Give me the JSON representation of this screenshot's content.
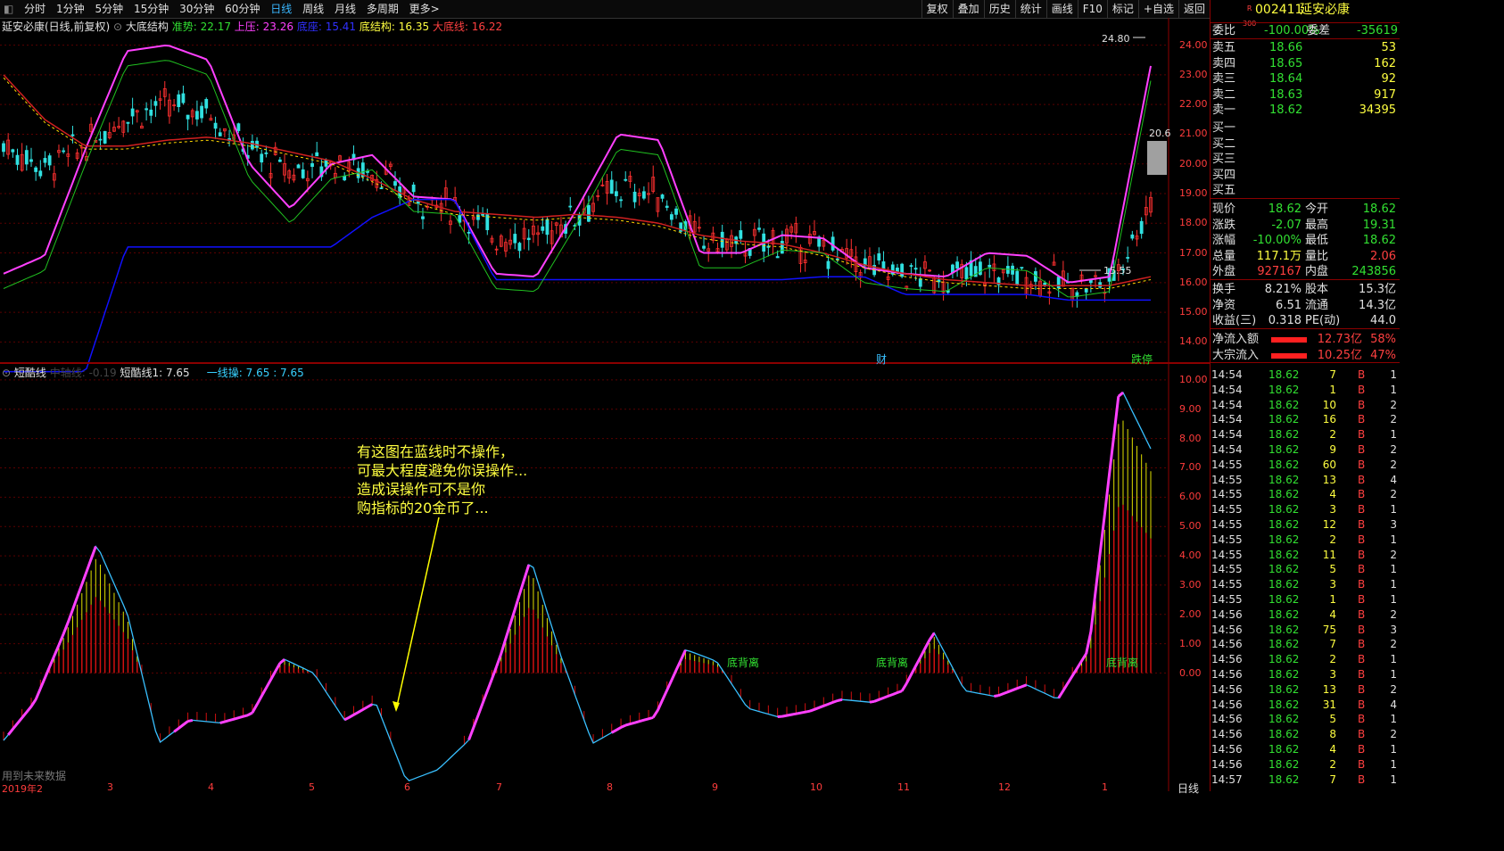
{
  "toolbar": {
    "periods": [
      "分时",
      "1分钟",
      "5分钟",
      "15分钟",
      "30分钟",
      "60分钟",
      "日线",
      "周线",
      "月线",
      "多周期",
      "更多>"
    ],
    "active_period": "日线",
    "right_buttons": [
      "复权",
      "叠加",
      "历史",
      "统计",
      "画线",
      "F10",
      "标记",
      "+自选",
      "返回"
    ]
  },
  "main_header": {
    "title": "延安必康(日线,前复权)",
    "indicator": "大底结构",
    "zhunshi": "准势: 22.17",
    "shangya": "上压: 23.26",
    "diceng": "底座: 15.41",
    "dijiegou": "底结构: 16.35",
    "dadixian": "大底线: 16.22"
  },
  "main_annotations": {
    "high": "24.80",
    "low": "15.55",
    "side": "20.6",
    "cai": "财",
    "dietei": "跌停"
  },
  "sub_header": {
    "name": "短酷线",
    "mid": "中轴线: -0.19",
    "line1": "短酷线1: 7.65",
    "line2": "一线操: 7.65",
    "line3": ": 7.65"
  },
  "annotation": {
    "lines": [
      "有这图在蓝线时不操作，",
      "可最大程度避免你误操作...",
      "造成误操作可不是你",
      "购指标的20金币了..."
    ]
  },
  "labels": {
    "dibeili1": "底背离",
    "dibeili2": "底背离",
    "dibeili3": "底背离",
    "future_data": "用到未来数据",
    "period_tab": "日线"
  },
  "chart_data": [
    {
      "type": "line",
      "title": "延安必康(日线,前复权)",
      "y_ticks": [
        "24.00",
        "23.00",
        "22.00",
        "21.00",
        "20.00",
        "19.00",
        "18.00",
        "17.00",
        "16.00",
        "15.00",
        "14.00"
      ],
      "ylim": [
        13.5,
        24.8
      ],
      "series": [
        {
          "name": "准势",
          "color": "#ff40ff",
          "values": [
            16.3,
            16.9,
            20.5,
            23.8,
            24.0,
            23.5,
            20.0,
            18.5,
            20.0,
            20.3,
            18.9,
            18.8,
            16.3,
            16.2,
            18.5,
            21.0,
            20.8,
            17.0,
            17.0,
            17.6,
            17.5,
            16.5,
            16.3,
            16.2,
            17.0,
            16.9,
            16.0,
            16.2,
            23.3
          ]
        },
        {
          "name": "大底线",
          "color": "#d02020",
          "values": [
            23.0,
            21.5,
            20.6,
            20.6,
            20.8,
            20.9,
            20.7,
            20.4,
            20.1,
            19.5,
            18.8,
            18.4,
            18.3,
            18.2,
            18.3,
            18.2,
            18.0,
            17.6,
            17.4,
            17.3,
            17.0,
            16.6,
            16.3,
            16.1,
            16.0,
            15.9,
            15.9,
            15.9,
            16.2
          ]
        },
        {
          "name": "底座",
          "color": "#1010ff",
          "values": [
            13.0,
            13.0,
            13.0,
            17.2,
            17.2,
            17.2,
            17.2,
            17.2,
            17.2,
            18.2,
            18.8,
            18.8,
            16.1,
            16.1,
            16.1,
            16.1,
            16.1,
            16.1,
            16.1,
            16.1,
            16.2,
            16.2,
            15.6,
            15.6,
            15.6,
            15.6,
            15.41,
            15.41,
            15.41
          ]
        }
      ]
    },
    {
      "type": "line",
      "title": "短酷线",
      "y_ticks": [
        "10.00",
        "9.00",
        "8.00",
        "7.00",
        "6.00",
        "5.00",
        "4.00",
        "3.00",
        "2.00",
        "1.00",
        "0.00"
      ],
      "ylim": [
        -4.0,
        10.3
      ],
      "x_labels": [
        "2019年2",
        "3",
        "4",
        "5",
        "6",
        "7",
        "8",
        "9",
        "10",
        "11",
        "12",
        "1"
      ],
      "series": [
        {
          "name": "短酷线1",
          "color": "#39c0ff",
          "values": [
            -2.3,
            -1.0,
            1.5,
            4.4,
            2.0,
            -2.4,
            -1.6,
            -1.7,
            -1.4,
            0.5,
            0.0,
            -1.6,
            -1.0,
            -3.7,
            -3.3,
            -2.3,
            0.5,
            3.9,
            0.5,
            -2.4,
            -1.8,
            -1.5,
            0.8,
            0.4,
            -1.2,
            -1.5,
            -1.3,
            -0.9,
            -1.0,
            -0.6,
            1.4,
            -0.6,
            -0.8,
            -0.4,
            -0.9,
            0.8,
            9.8,
            7.65
          ]
        }
      ]
    }
  ],
  "quote": {
    "code": "002411",
    "name": "延安必康",
    "weibi_label": "委比",
    "weibi": "-100.00%",
    "weicha_label": "委差",
    "weicha": "-35619",
    "asks": [
      {
        "label": "卖五",
        "price": "18.66",
        "vol": "53"
      },
      {
        "label": "卖四",
        "price": "18.65",
        "vol": "162"
      },
      {
        "label": "卖三",
        "price": "18.64",
        "vol": "92"
      },
      {
        "label": "卖二",
        "price": "18.63",
        "vol": "917"
      },
      {
        "label": "卖一",
        "price": "18.62",
        "vol": "34395"
      }
    ],
    "bids": [
      {
        "label": "买一",
        "price": "",
        "vol": ""
      },
      {
        "label": "买二",
        "price": "",
        "vol": ""
      },
      {
        "label": "买三",
        "price": "",
        "vol": ""
      },
      {
        "label": "买四",
        "price": "",
        "vol": ""
      },
      {
        "label": "买五",
        "price": "",
        "vol": ""
      }
    ],
    "stats": [
      {
        "l1": "现价",
        "v1": "18.62",
        "c1": "green",
        "l2": "今开",
        "v2": "18.62",
        "c2": "green"
      },
      {
        "l1": "涨跌",
        "v1": "-2.07",
        "c1": "green",
        "l2": "最高",
        "v2": "19.31",
        "c2": "green"
      },
      {
        "l1": "涨幅",
        "v1": "-10.00%",
        "c1": "green",
        "l2": "最低",
        "v2": "18.62",
        "c2": "green"
      },
      {
        "l1": "总量",
        "v1": "117.1万",
        "c1": "yellow",
        "l2": "量比",
        "v2": "2.06",
        "c2": "red"
      },
      {
        "l1": "外盘",
        "v1": "927167",
        "c1": "red",
        "l2": "内盘",
        "v2": "243856",
        "c2": "green"
      }
    ],
    "stats2": [
      {
        "l1": "换手",
        "v1": "8.21%",
        "l2": "股本",
        "v2": "15.3亿"
      },
      {
        "l1": "净资",
        "v1": "6.51",
        "l2": "流通",
        "v2": "14.3亿"
      },
      {
        "l1": "收益(三)",
        "v1": "0.318",
        "l2": "PE(动)",
        "v2": "44.0"
      }
    ],
    "flows": [
      {
        "label": "净流入额",
        "value": "12.73亿",
        "pct": "58%"
      },
      {
        "label": "大宗流入",
        "value": "10.25亿",
        "pct": "47%"
      }
    ]
  },
  "trades": [
    {
      "t": "14:54",
      "p": "18.62",
      "v": "7",
      "s": "B",
      "n": "1"
    },
    {
      "t": "14:54",
      "p": "18.62",
      "v": "1",
      "s": "B",
      "n": "1"
    },
    {
      "t": "14:54",
      "p": "18.62",
      "v": "10",
      "s": "B",
      "n": "2"
    },
    {
      "t": "14:54",
      "p": "18.62",
      "v": "16",
      "s": "B",
      "n": "2"
    },
    {
      "t": "14:54",
      "p": "18.62",
      "v": "2",
      "s": "B",
      "n": "1"
    },
    {
      "t": "14:54",
      "p": "18.62",
      "v": "9",
      "s": "B",
      "n": "2"
    },
    {
      "t": "14:55",
      "p": "18.62",
      "v": "60",
      "s": "B",
      "n": "2"
    },
    {
      "t": "14:55",
      "p": "18.62",
      "v": "13",
      "s": "B",
      "n": "4"
    },
    {
      "t": "14:55",
      "p": "18.62",
      "v": "4",
      "s": "B",
      "n": "2"
    },
    {
      "t": "14:55",
      "p": "18.62",
      "v": "3",
      "s": "B",
      "n": "1"
    },
    {
      "t": "14:55",
      "p": "18.62",
      "v": "12",
      "s": "B",
      "n": "3"
    },
    {
      "t": "14:55",
      "p": "18.62",
      "v": "2",
      "s": "B",
      "n": "1"
    },
    {
      "t": "14:55",
      "p": "18.62",
      "v": "11",
      "s": "B",
      "n": "2"
    },
    {
      "t": "14:55",
      "p": "18.62",
      "v": "5",
      "s": "B",
      "n": "1"
    },
    {
      "t": "14:55",
      "p": "18.62",
      "v": "3",
      "s": "B",
      "n": "1"
    },
    {
      "t": "14:55",
      "p": "18.62",
      "v": "1",
      "s": "B",
      "n": "1"
    },
    {
      "t": "14:56",
      "p": "18.62",
      "v": "4",
      "s": "B",
      "n": "2"
    },
    {
      "t": "14:56",
      "p": "18.62",
      "v": "75",
      "s": "B",
      "n": "3"
    },
    {
      "t": "14:56",
      "p": "18.62",
      "v": "7",
      "s": "B",
      "n": "2"
    },
    {
      "t": "14:56",
      "p": "18.62",
      "v": "2",
      "s": "B",
      "n": "1"
    },
    {
      "t": "14:56",
      "p": "18.62",
      "v": "3",
      "s": "B",
      "n": "1"
    },
    {
      "t": "14:56",
      "p": "18.62",
      "v": "13",
      "s": "B",
      "n": "2"
    },
    {
      "t": "14:56",
      "p": "18.62",
      "v": "31",
      "s": "B",
      "n": "4"
    },
    {
      "t": "14:56",
      "p": "18.62",
      "v": "5",
      "s": "B",
      "n": "1"
    },
    {
      "t": "14:56",
      "p": "18.62",
      "v": "8",
      "s": "B",
      "n": "2"
    },
    {
      "t": "14:56",
      "p": "18.62",
      "v": "4",
      "s": "B",
      "n": "1"
    },
    {
      "t": "14:56",
      "p": "18.62",
      "v": "2",
      "s": "B",
      "n": "1"
    },
    {
      "t": "14:57",
      "p": "18.62",
      "v": "7",
      "s": "B",
      "n": "1"
    }
  ]
}
